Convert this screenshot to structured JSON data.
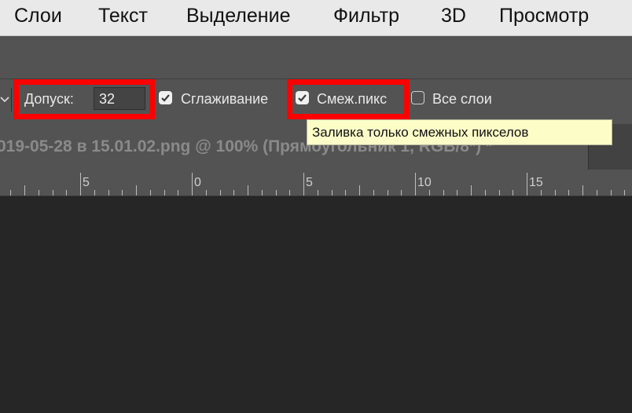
{
  "menubar": {
    "items": [
      "Слои",
      "Текст",
      "Выделение",
      "Фильтр",
      "3D",
      "Просмотр"
    ]
  },
  "options": {
    "tolerance_label": "Допуск:",
    "tolerance_value": "32",
    "antialias_label": "Сглаживание",
    "antialias_checked": true,
    "contiguous_label": "Смеж.пикс",
    "contiguous_checked": true,
    "all_layers_label": "Все слои",
    "all_layers_checked": false
  },
  "tooltip": {
    "text": "Заливка только смежных пикселов"
  },
  "document": {
    "tab_title": "019-05-28 в 15.01.02.png @ 100% (Прямоугольник 1, RGB/8*) *"
  },
  "ruler": {
    "labels": [
      "5",
      "0",
      "5",
      "10",
      "15"
    ]
  },
  "colors": {
    "highlight": "#ff0000",
    "tooltip_bg": "#fdfdc8"
  }
}
